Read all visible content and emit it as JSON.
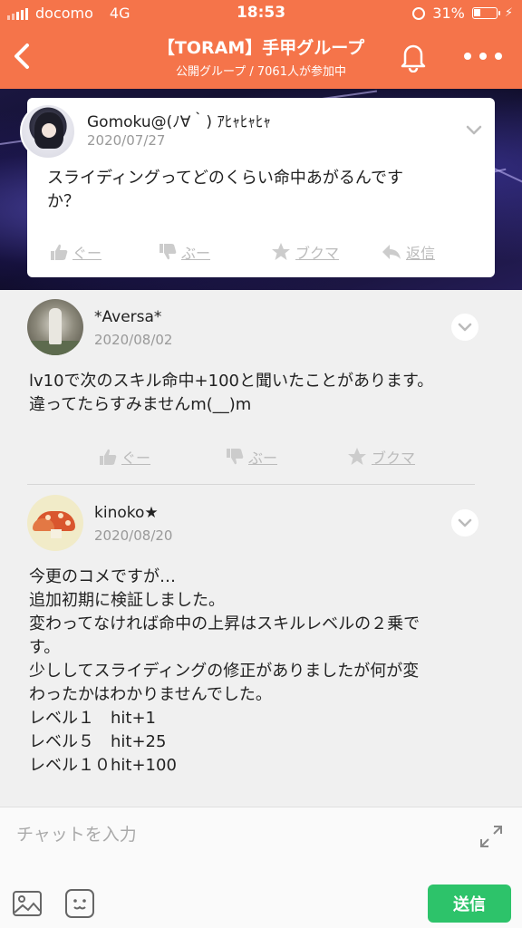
{
  "status_bar": {
    "carrier": "docomo",
    "network": "4G",
    "time": "18:53",
    "battery": "31%",
    "battery_level": 0.31
  },
  "header": {
    "title": "【TORAM】手甲グループ",
    "subtitle": "公開グループ / 7061人が参加中",
    "back_icon": "chevron-left-icon",
    "bell_icon": "bell-icon",
    "more_icon": "more-horizontal-icon"
  },
  "pinned_post": {
    "author": "Gomoku@(ﾉ∀｀) ｱﾋｬﾋｬﾋｬ",
    "date": "2020/07/27",
    "body_lines": [
      "スライディングってどのくらい命中あがるんです",
      "か？"
    ],
    "actions": {
      "good": "ぐー",
      "boo": "ぶー",
      "bookmark": "ブクマ",
      "reply": "返信"
    }
  },
  "comments": [
    {
      "author": "*Aversa*",
      "date": "2020/08/02",
      "body_lines": [
        "lv10で次のスキル命中+100と聞いたことがあります。",
        "違ってたらすみませんm(__)m"
      ],
      "actions": {
        "good": "ぐー",
        "boo": "ぶー",
        "bookmark": "ブクマ"
      }
    },
    {
      "author": "kinoko★",
      "date": "2020/08/20",
      "body_lines": [
        "今更のコメですが…",
        "追加初期に検証しました。",
        "変わってなければ命中の上昇はスキルレベルの２乗で",
        "す。",
        "少ししてスライディングの修正がありましたが何が変",
        "わったかはわかりませんでした。",
        "レベル１　hit+1",
        "レベル５　hit+25",
        "レベル１０hit+100"
      ]
    }
  ],
  "composer": {
    "placeholder": "チャットを入力",
    "send_label": "送信"
  },
  "colors": {
    "header": "#f5744a",
    "send": "#2dc36a",
    "action_gray": "#bbbbbb"
  }
}
